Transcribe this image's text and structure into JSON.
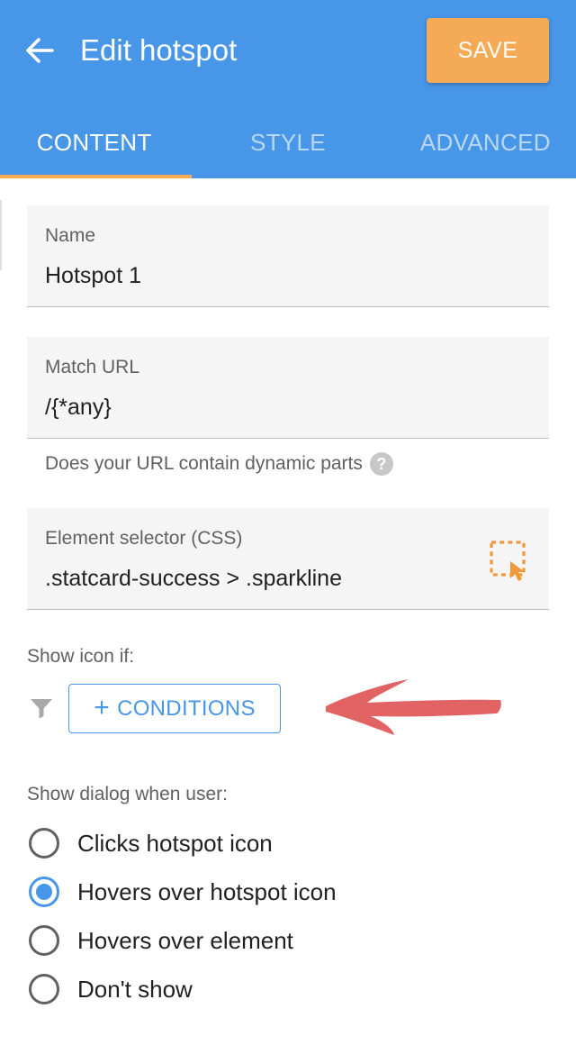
{
  "theme": {
    "primary": "#4896e8",
    "accent": "#f5ab55",
    "blue": "#4896e8",
    "annotation_red": "#e05656"
  },
  "header": {
    "title": "Edit hotspot",
    "back_icon": "arrow-left-icon",
    "save_label": "SAVE"
  },
  "tabs": [
    {
      "label": "CONTENT",
      "active": true
    },
    {
      "label": "STYLE",
      "active": false
    },
    {
      "label": "ADVANCED",
      "active": false
    }
  ],
  "fields": {
    "name": {
      "label": "Name",
      "value": "Hotspot 1"
    },
    "match_url": {
      "label": "Match URL",
      "value": "/{*any}",
      "help": "Does your URL contain dynamic parts",
      "help_icon": "?"
    },
    "selector": {
      "label": "Element selector (CSS)",
      "value": ".statcard-success > .sparkline",
      "picker_icon": "element-picker-icon"
    }
  },
  "show_icon": {
    "label": "Show icon if:",
    "filter_icon": "filter-icon",
    "conditions_plus": "+",
    "conditions_label": "CONDITIONS"
  },
  "show_dialog": {
    "label": "Show dialog when user:",
    "options": [
      {
        "label": "Clicks hotspot icon",
        "checked": false
      },
      {
        "label": "Hovers over hotspot icon",
        "checked": true
      },
      {
        "label": "Hovers over element",
        "checked": false
      },
      {
        "label": "Don't show",
        "checked": false
      }
    ]
  }
}
